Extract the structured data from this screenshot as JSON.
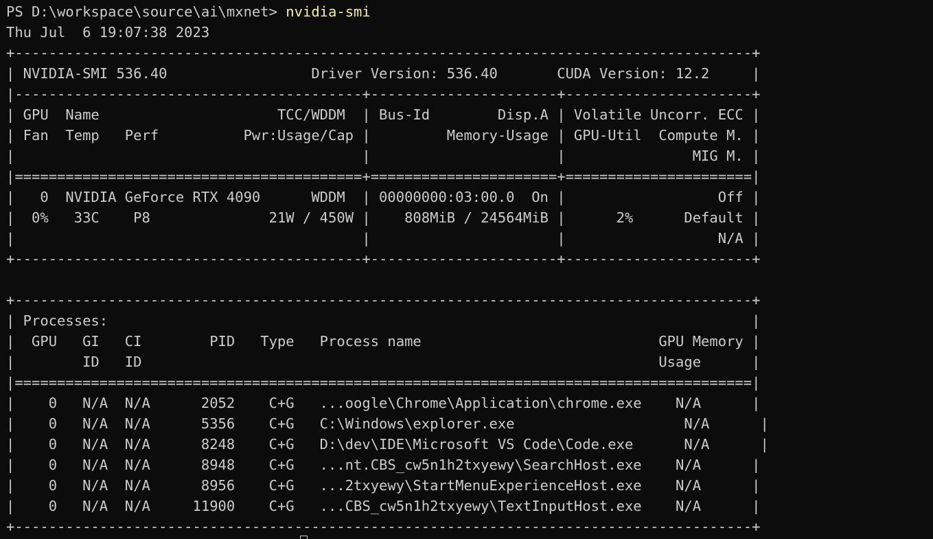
{
  "prompt": {
    "path": "PS D:\\workspace\\source\\ai\\mxnet> ",
    "command": "nvidia-smi"
  },
  "output_lines": [
    "Thu Jul  6 19:07:38 2023",
    "+---------------------------------------------------------------------------------------+",
    "| NVIDIA-SMI 536.40                 Driver Version: 536.40       CUDA Version: 12.2     |",
    "|-----------------------------------------+----------------------+----------------------+",
    "| GPU  Name                     TCC/WDDM  | Bus-Id        Disp.A | Volatile Uncorr. ECC |",
    "| Fan  Temp   Perf          Pwr:Usage/Cap |         Memory-Usage | GPU-Util  Compute M. |",
    "|                                         |                      |               MIG M. |",
    "|=========================================+======================+======================|",
    "|   0  NVIDIA GeForce RTX 4090      WDDM  | 00000000:03:00.0  On |                  Off |",
    "|  0%   33C    P8              21W / 450W |    808MiB / 24564MiB |      2%      Default |",
    "|                                         |                      |                  N/A |",
    "+-----------------------------------------+----------------------+----------------------+",
    "",
    "+---------------------------------------------------------------------------------------+",
    "| Processes:                                                                            |",
    "|  GPU   GI   CI        PID   Type   Process name                            GPU Memory |",
    "|        ID   ID                                                             Usage      |",
    "|=======================================================================================|",
    "|    0   N/A  N/A      2052    C+G   ...oogle\\Chrome\\Application\\chrome.exe    N/A      |",
    "|    0   N/A  N/A      5356    C+G   C:\\Windows\\explorer.exe                    N/A      |",
    "|    0   N/A  N/A      8248    C+G   D:\\dev\\IDE\\Microsoft VS Code\\Code.exe      N/A      |",
    "|    0   N/A  N/A      8948    C+G   ...nt.CBS_cw5n1h2txyewy\\SearchHost.exe    N/A      |",
    "|    0   N/A  N/A      8956    C+G   ...2txyewy\\StartMenuExperienceHost.exe    N/A      |",
    "|    0   N/A  N/A     11900    C+G   ...CBS_cw5n1h2txyewy\\TextInputHost.exe    N/A      |",
    "+---------------------------------------------------------------------------------------+"
  ],
  "colors": {
    "background": "#0c0c0c",
    "text": "#cccccc",
    "command": "#f9f1a5"
  }
}
